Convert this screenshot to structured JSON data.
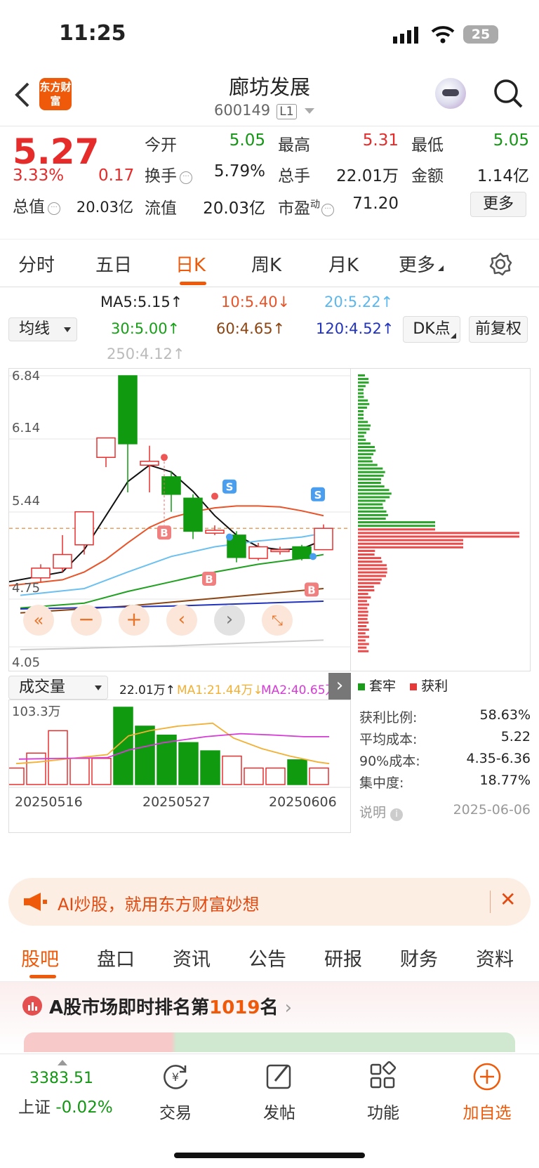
{
  "status_bar": {
    "time": "11:25",
    "battery": "25"
  },
  "header": {
    "title": "廊坊发展",
    "code": "600149",
    "level": "L1",
    "logo_text": "东方财富"
  },
  "quote": {
    "price": "5.27",
    "change_pct": "3.33%",
    "change": "0.17",
    "open_label": "今开",
    "open": "5.05",
    "high_label": "最高",
    "high": "5.31",
    "low_label": "最低",
    "low": "5.05",
    "turnover_label": "换手",
    "turnover": "5.79%",
    "volume_label": "总手",
    "volume": "22.01万",
    "amount_label": "金额",
    "amount": "1.14亿",
    "mktcap_label": "总值",
    "mktcap": "20.03亿",
    "float_label": "流值",
    "float": "20.03亿",
    "pe_label": "市盈",
    "pe_sup": "动",
    "pe": "71.20",
    "more_label": "更多"
  },
  "kline_tabs": [
    "分时",
    "五日",
    "日K",
    "周K",
    "月K",
    "更多"
  ],
  "ma": {
    "selector": "均线",
    "ma5": "MA5:5.15↑",
    "ma10": "10:5.40↓",
    "ma20": "20:5.22↑",
    "ma30": "30:5.00↑",
    "ma60": "60:4.65↑",
    "ma120": "120:4.52↑",
    "ma250": "250:4.12↑",
    "dk_label": "DK点",
    "fq_label": "前复权"
  },
  "price_axis": [
    "6.84",
    "6.14",
    "5.44",
    "4.75",
    "4.05"
  ],
  "vol_bar": {
    "selector": "成交量",
    "vol": "22.01万↑",
    "ma1": "MA1:21.44万↓",
    "ma2": "MA2:40.65万",
    "top": "103.3万",
    "dates": [
      "20250516",
      "20250527",
      "20250606"
    ]
  },
  "chip": {
    "legend_trap": "套牢",
    "legend_profit": "获利",
    "rows": [
      {
        "label": "获利比例:",
        "value": "58.63%"
      },
      {
        "label": "平均成本:",
        "value": "5.22"
      },
      {
        "label": "90%成本:",
        "value": "4.35-6.36"
      },
      {
        "label": "集中度:",
        "value": "18.77%"
      }
    ],
    "note": "说明",
    "date": "2025-06-06"
  },
  "colors": {
    "up": "#e62b2b",
    "down": "#149614",
    "accent": "#ee5a0a"
  },
  "chart_data": {
    "type": "candlestick",
    "ylim": [
      4.05,
      6.84
    ],
    "candles": [
      {
        "o": 4.76,
        "c": 4.86,
        "h": 4.9,
        "l": 4.72
      },
      {
        "o": 4.86,
        "c": 5.0,
        "h": 5.2,
        "l": 4.82
      },
      {
        "o": 5.1,
        "c": 5.44,
        "h": 5.44,
        "l": 5.0
      },
      {
        "o": 6.0,
        "c": 6.2,
        "h": 6.2,
        "l": 5.9
      },
      {
        "o": 6.84,
        "c": 6.14,
        "h": 6.84,
        "l": 5.64
      },
      {
        "o": 5.92,
        "c": 5.96,
        "h": 6.12,
        "l": 5.64
      },
      {
        "o": 5.8,
        "c": 5.62,
        "h": 5.86,
        "l": 5.44
      },
      {
        "o": 5.58,
        "c": 5.24,
        "h": 5.62,
        "l": 5.16
      },
      {
        "o": 5.22,
        "c": 5.25,
        "h": 5.3,
        "l": 5.2
      },
      {
        "o": 5.2,
        "c": 4.97,
        "h": 5.24,
        "l": 4.92
      },
      {
        "o": 4.96,
        "c": 5.08,
        "h": 5.12,
        "l": 4.94
      },
      {
        "o": 5.03,
        "c": 5.05,
        "h": 5.08,
        "l": 5.0
      },
      {
        "o": 5.08,
        "c": 4.96,
        "h": 5.1,
        "l": 4.94
      },
      {
        "o": 5.05,
        "c": 5.27,
        "h": 5.31,
        "l": 5.05
      }
    ],
    "volumes": [
      22,
      42,
      72,
      35,
      35,
      103.3,
      78,
      66,
      56,
      45,
      38,
      22,
      22,
      33,
      22.01
    ]
  },
  "ai_banner": "AI炒股，就用东方财富妙想",
  "gu_tabs": [
    "股吧",
    "盘口",
    "资讯",
    "公告",
    "研报",
    "财务",
    "资料"
  ],
  "rank": {
    "text": "A股市场即时排名第",
    "num": "1019",
    "suffix": "名"
  },
  "bottom_nav": {
    "index_value": "3383.51",
    "index_name": "上证",
    "index_change": "-0.02%",
    "items": [
      "交易",
      "发帖",
      "功能",
      "加自选"
    ]
  }
}
